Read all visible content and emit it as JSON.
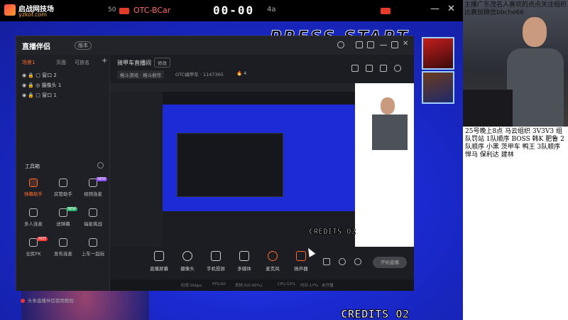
{
  "topbar": {
    "logo_name": "启战网技场",
    "logo_url": "yzkof.com",
    "p1_tag": "50",
    "p2_name": "OTC-BCar",
    "timer": "00-00",
    "p3_name": "4a"
  },
  "game": {
    "press_start": "PRESS START",
    "credits_main": "CREDITS 02",
    "credits_preview": "CREDITS 02"
  },
  "sidebar": {
    "cam_text": "主播广东茂名人喜欢的点点关注组织比赛加微信bbche66",
    "notice": "25号晚上8点  马云组织 3V3V3  组队罚站 1队顺序 BOSS 韩K 肥鲁 2队顺序 小黑 茨甲车 鸭王 3队顺序 悍马 保利达 建林"
  },
  "app": {
    "name": "直播伴侣",
    "version": "版本",
    "tabs": [
      "场景1",
      "页面",
      "可放名"
    ],
    "scenes": [
      "窗口 2",
      "摄像头 1",
      "窗口 1"
    ],
    "tools_header": "工具箱",
    "tools": [
      {
        "label": "弹幕助手",
        "hot": true,
        "badge": ""
      },
      {
        "label": "房管助手",
        "hot": false,
        "badge": ""
      },
      {
        "label": "视频连麦",
        "hot": false,
        "badge": "NEW"
      },
      {
        "label": "多人连麦",
        "hot": false,
        "badge": ""
      },
      {
        "label": "送弹幕",
        "hot": false,
        "badge": "NEW"
      },
      {
        "label": "福星挑战",
        "hot": false,
        "badge": ""
      },
      {
        "label": "全民PK",
        "hot": false,
        "badge": "HOT"
      },
      {
        "label": "发布连麦",
        "hot": false,
        "badge": ""
      },
      {
        "label": "上车一起玩",
        "hot": false,
        "badge": ""
      }
    ],
    "tip": "头条直播伴侣使用教程",
    "room_title": "骑甲车直播间",
    "edit_label": "修改",
    "category": "格斗游戏 · 格斗射作",
    "room_id_label": "OTC编甲车 · 1147365",
    "viewers": "4",
    "bottom_buttons": [
      "直播屏幕",
      "摄像头",
      "手机投屏",
      "多媒体",
      "麦克风",
      "扬声器"
    ],
    "start_label": "开始直播",
    "status": [
      "码率:0kbps",
      "FPS:60",
      "丢帧:0(0.00%)",
      "CPU:15%",
      "内存:17%",
      "未开播"
    ]
  }
}
